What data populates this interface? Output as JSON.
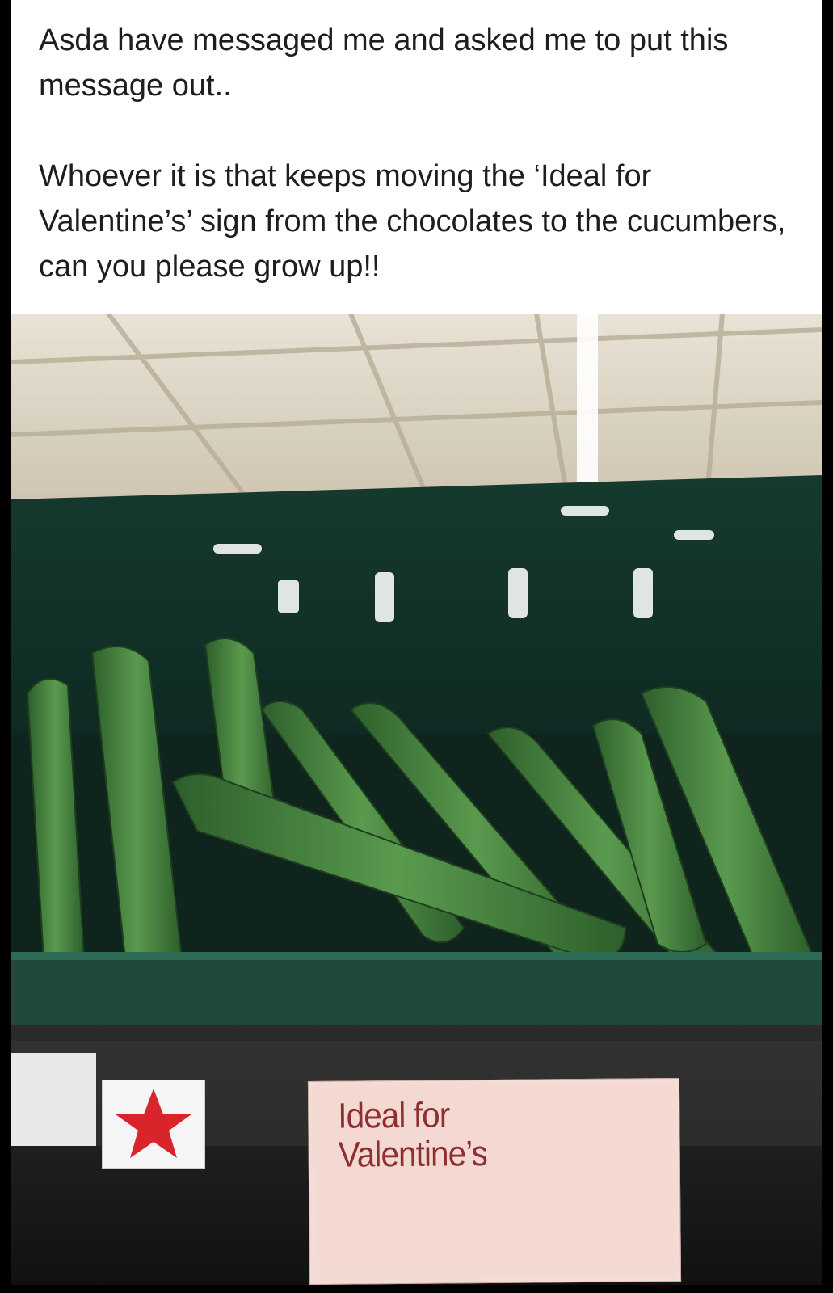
{
  "post": {
    "paragraph_1": "Asda have messaged me and asked me to put this message out..",
    "paragraph_2": "Whoever it is that keeps moving the ‘Ideal for Valentine’s’ sign from the chocolates to the cucumbers, can you please grow up!!"
  },
  "photo": {
    "subject": "cucumbers",
    "sign": {
      "line_1": "Ideal for",
      "line_2": "Valentine’s"
    },
    "colors": {
      "sign_text": "#8e2f31",
      "sign_bg": "#f3d9d2",
      "star": "#d9242b",
      "crate": "#1f4a3b",
      "cucumber": "#3f7d3a"
    }
  }
}
